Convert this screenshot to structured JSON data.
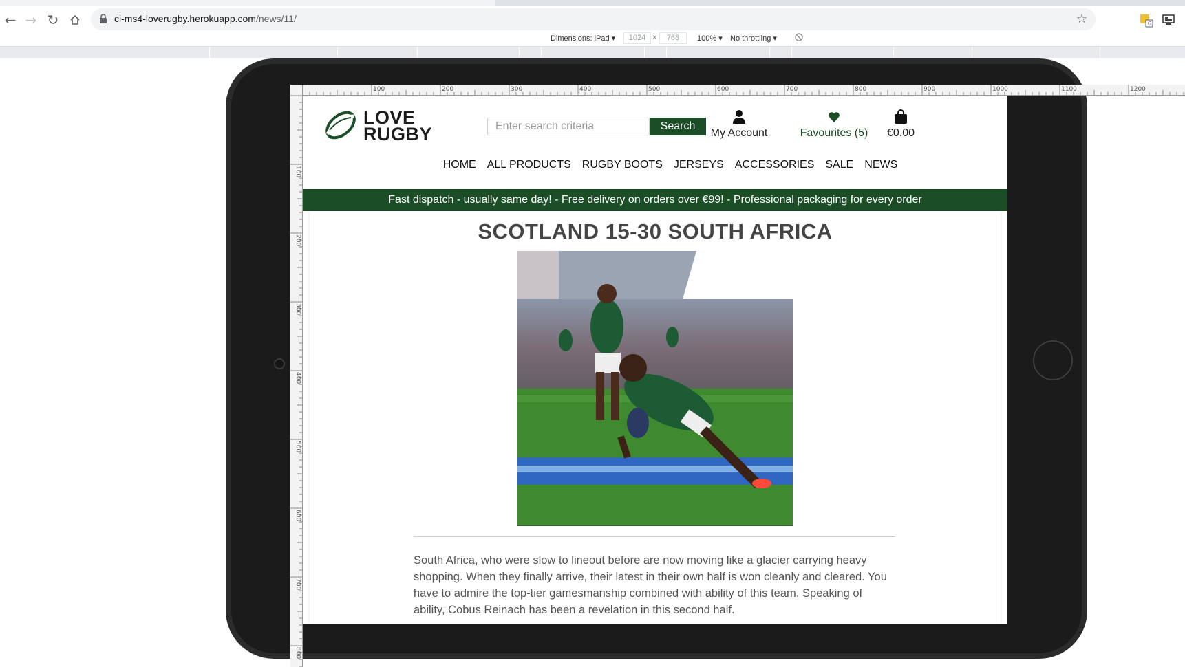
{
  "browser": {
    "url_host": "ci-ms4-loverugby.herokuapp.com",
    "url_path": "/news/11/",
    "icons": {
      "back": "back-arrow-icon",
      "forward": "forward-arrow-icon",
      "reload": "reload-icon",
      "home": "home-icon",
      "lock": "lock-icon",
      "bookmark": "star-icon"
    },
    "extension_badge": "6"
  },
  "devtools": {
    "dimensions_label": "Dimensions: iPad ▾",
    "width": "1024",
    "times": "×",
    "height": "768",
    "zoom": "100% ▾",
    "throttling": "No throttling ▾"
  },
  "rulers": {
    "top_labels": [
      "100",
      "200",
      "300",
      "400",
      "500",
      "600",
      "700",
      "800",
      "900",
      "1000",
      "1100",
      "1200"
    ],
    "left_labels": [
      "100",
      "200",
      "300",
      "400",
      "500",
      "600",
      "700",
      "800"
    ]
  },
  "site": {
    "logo": {
      "line1": "LOVE",
      "line2": "RUGBY"
    },
    "search": {
      "placeholder": "Enter search criteria",
      "button": "Search"
    },
    "header_links": {
      "account": "My Account",
      "favourites": "Favourites (5)",
      "bag": "€0.00"
    },
    "nav": [
      "HOME",
      "ALL PRODUCTS",
      "RUGBY BOOTS",
      "JERSEYS",
      "ACCESSORIES",
      "SALE",
      "NEWS"
    ],
    "banner": "Fast dispatch - usually same day! - Free delivery on orders over €99! - Professional packaging for every order",
    "colors": {
      "brand_green": "#1b4d26"
    }
  },
  "article": {
    "title": "SCOTLAND 15-30 SOUTH AFRICA",
    "body": "South Africa, who were slow to lineout before are now moving like a glacier carrying heavy shopping. When they finally arrive, their latest in their own half is won cleanly and cleared. You have to admire the top-tier gamesmanship combined with ability of this team. Speaking of ability, Cobus Reinach has been a revelation in this second half."
  }
}
